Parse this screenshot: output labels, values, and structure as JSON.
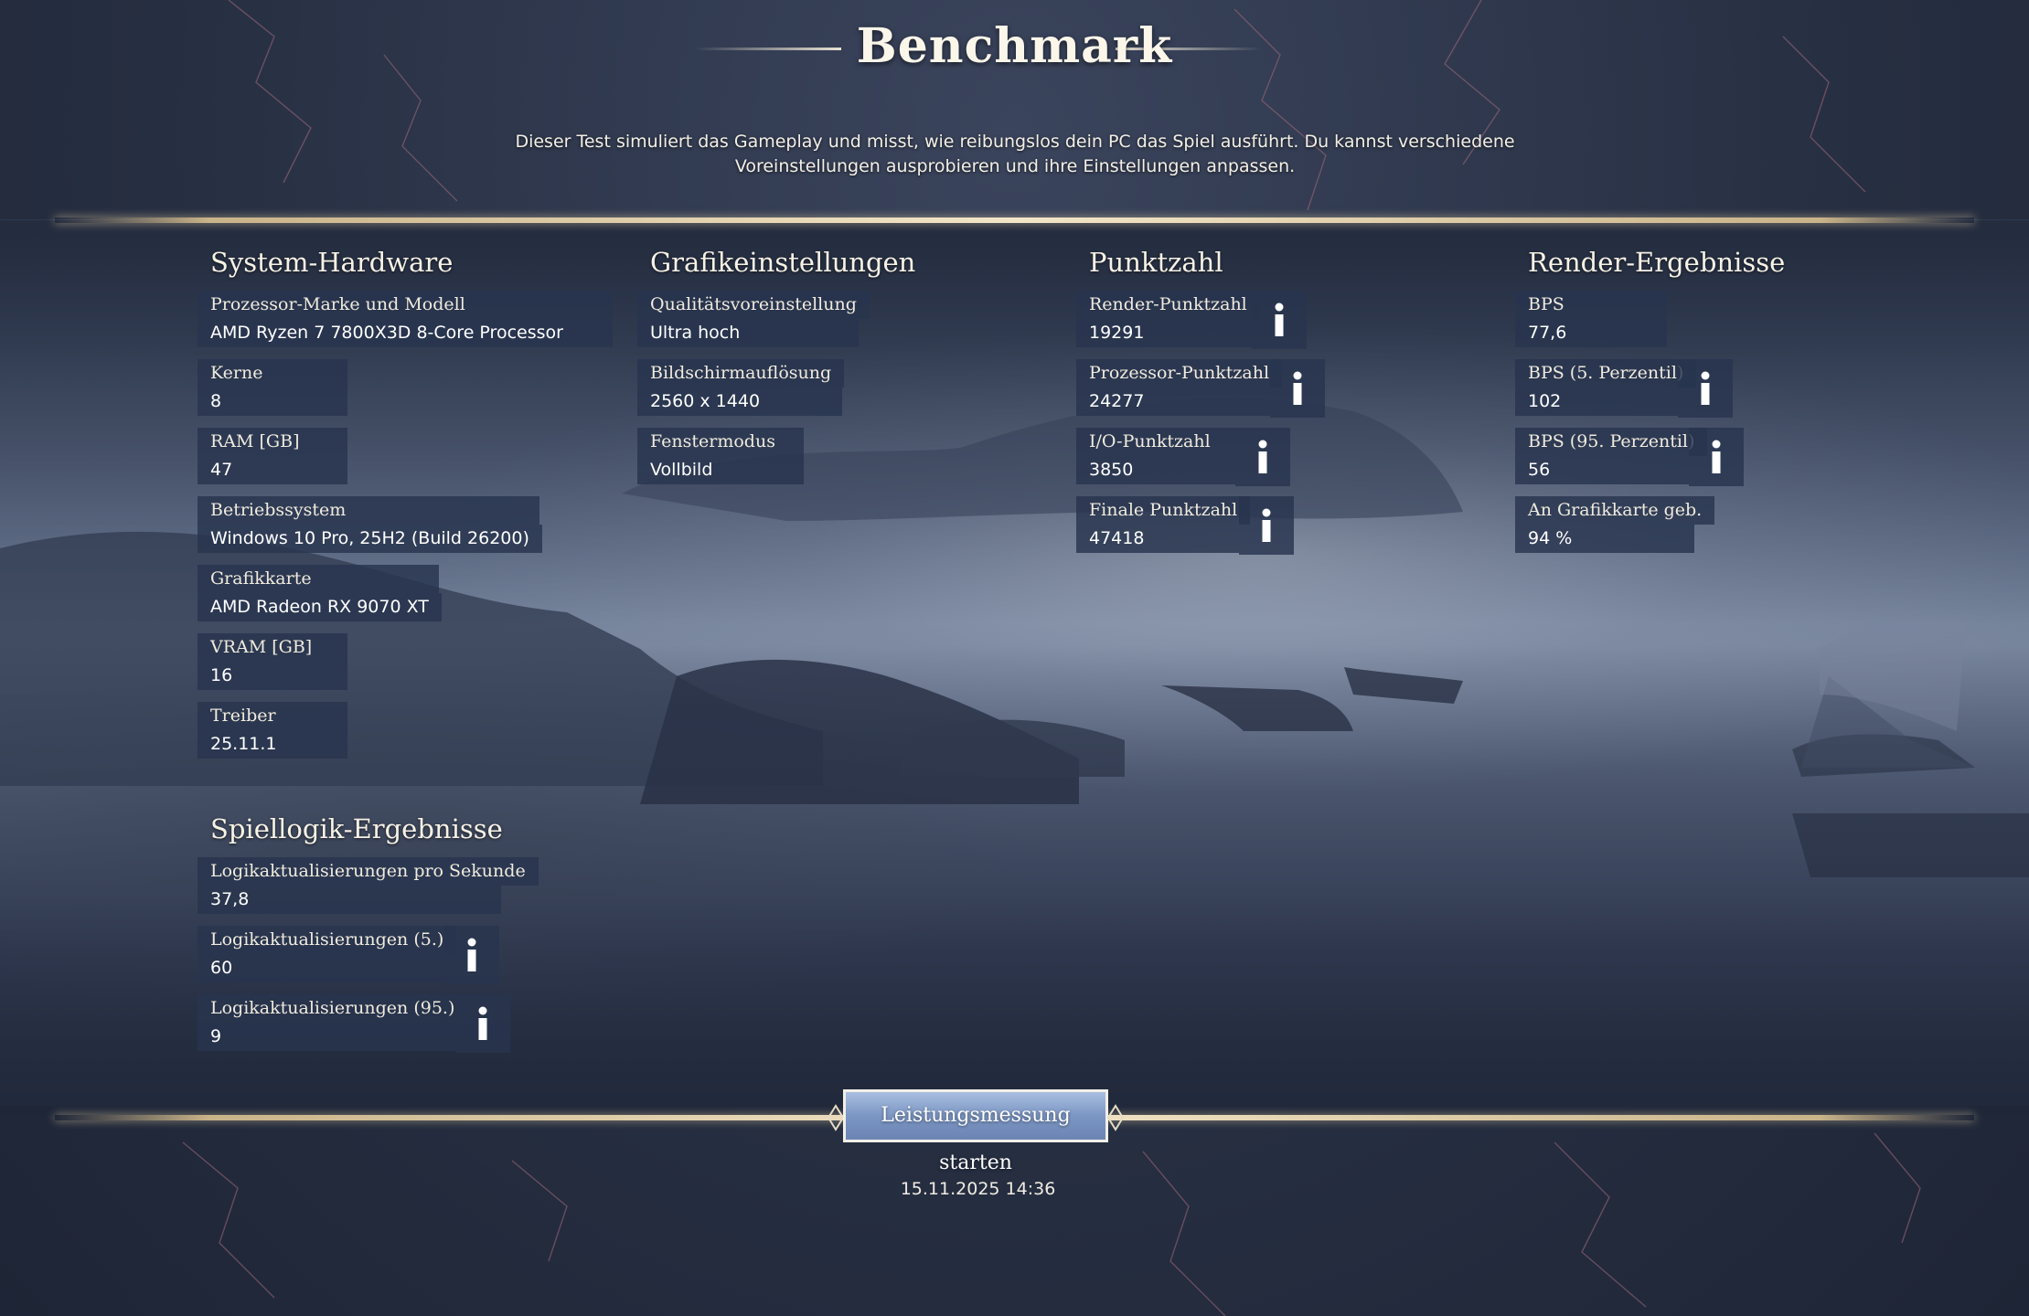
{
  "header": {
    "title": "Benchmark",
    "description": "Dieser Test simuliert das Gameplay und misst, wie reibungslos dein PC das Spiel ausführt. Du kannst verschiedene Voreinstellungen ausprobieren und ihre Einstellungen anpassen."
  },
  "hardware": {
    "heading": "System-Hardware",
    "items": [
      {
        "label": "Prozessor-Marke und Modell",
        "value": "AMD Ryzen 7 7800X3D 8-Core Processor"
      },
      {
        "label": "Kerne",
        "value": "8"
      },
      {
        "label": "RAM [GB]",
        "value": "47"
      },
      {
        "label": "Betriebssystem",
        "value": "Windows 10 Pro, 25H2 (Build 26200)"
      },
      {
        "label": "Grafikkarte",
        "value": "AMD Radeon RX 9070 XT"
      },
      {
        "label": "VRAM [GB]",
        "value": "16"
      },
      {
        "label": "Treiber",
        "value": "25.11.1"
      }
    ]
  },
  "logic": {
    "heading": "Spiellogik-Ergebnisse",
    "items": [
      {
        "label": "Logikaktualisierungen pro Sekunde",
        "value": "37,8"
      },
      {
        "label": "Logikaktualisierungen (5.)",
        "value": "60"
      },
      {
        "label": "Logikaktualisierungen (95.)",
        "value": "9"
      }
    ]
  },
  "graphics": {
    "heading": "Grafikeinstellungen",
    "items": [
      {
        "label": "Qualitätsvoreinstellung",
        "value": "Ultra hoch"
      },
      {
        "label": "Bildschirmauflösung",
        "value": "2560 x 1440"
      },
      {
        "label": "Fenstermodus",
        "value": "Vollbild"
      }
    ]
  },
  "score": {
    "heading": "Punktzahl",
    "items": [
      {
        "label": "Render-Punktzahl",
        "value": "19291"
      },
      {
        "label": "Prozessor-Punktzahl",
        "value": "24277"
      },
      {
        "label": "I/O-Punktzahl",
        "value": "3850"
      },
      {
        "label": "Finale Punktzahl",
        "value": "47418"
      }
    ]
  },
  "render": {
    "heading": "Render-Ergebnisse",
    "items": [
      {
        "label": "BPS",
        "value": "77,6"
      },
      {
        "label": "BPS (5. Perzentil)",
        "value": "102"
      },
      {
        "label": "BPS (95. Perzentil)",
        "value": "56"
      },
      {
        "label": "An Grafikkarte geb.",
        "value": "94 %"
      }
    ]
  },
  "footer": {
    "start_button": "Leistungsmessung starten",
    "timestamp": "15.11.2025 14:36"
  },
  "colors": {
    "accent_gold": "#f3e6c8",
    "panel_bg": "#28344e",
    "button_fill": "#7c96c4"
  },
  "icons": {
    "info": "info-icon",
    "ornament": "diamond-ornament-icon"
  }
}
